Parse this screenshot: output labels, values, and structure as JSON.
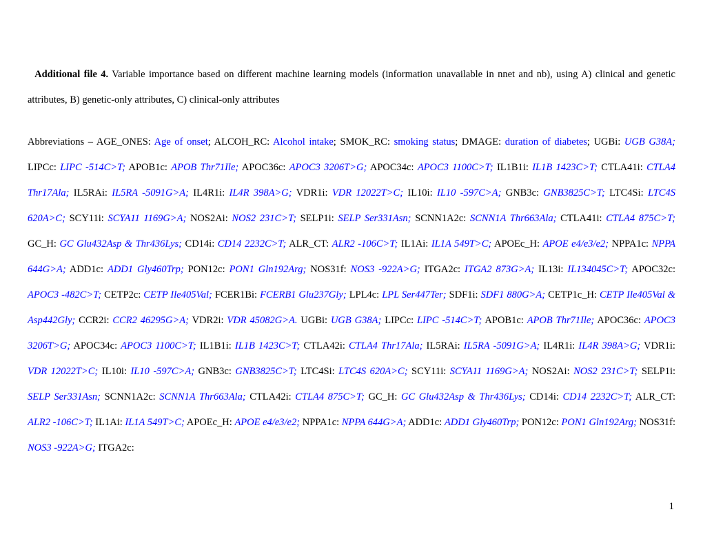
{
  "title_label": "Additional file 4.",
  "title_rest": " Variable importance based on different machine learning models (information unavailable in nnet and nb), using A) clinical and genetic attributes, B) genetic-only attributes, C) clinical-only attributes",
  "page_number": "1",
  "abbr": {
    "lead": "Abbreviations – AGE_ONES: ",
    "age_onset": "Age of onset",
    "alcoh_lbl": "; ALCOH_RC: ",
    "alcoh": "Alcohol intake",
    "smok_lbl": "; SMOK_RC: ",
    "smok": "smoking status",
    "dmage_lbl": "; DMAGE: ",
    "dmage": "duration of diabetes",
    "ugbi_lbl": "; UGBi: ",
    "ugbi": "UGB G38A;",
    "lipcc_lbl": " LIPCc: ",
    "lipcc": "LIPC -514C>T;",
    "apob1c_lbl": " APOB1c: ",
    "apob1c": "APOB  Thr71Ile;",
    "apoc36c_lbl": " APOC36c: ",
    "apoc36c": "APOC3 3206T>G;",
    "apoc34c_lbl": " APOC34c: ",
    "apoc34c": "APOC3 1100C>T;",
    "il1b1i_lbl": " IL1B1i: ",
    "il1b1i": "IL1B 1423C>T;",
    "ctla41i_lbl": " CTLA41i: ",
    "ctla41i": "CTLA4 Thr17Ala;",
    "il5rai_lbl": "  IL5RAi: ",
    "il5rai": "IL5RA -5091G>A;",
    "il4r1i_lbl": " IL4R1i: ",
    "il4r1i": "IL4R 398A>G;",
    "vdr1i_lbl": " VDR1i: ",
    "vdr1i": "VDR 12022T>C;",
    "il10i_lbl": " IL10i: ",
    "il10i": "IL10 -597C>A;",
    "gnb3c_lbl": " GNB3c: ",
    "gnb3c": "GNB3825C>T;",
    "ltc4si_lbl": " LTC4Si: ",
    "ltc4si": "LTC4S 620A>C;",
    "scy11i_lbl": " SCY11i: ",
    "scy11i": "SCYA11 1169G>A;",
    "nos2ai_lbl": " NOS2Ai: ",
    "nos2ai": "NOS2 231C>T;",
    "selp1i_lbl": " SELP1i: ",
    "selp1i": "SELP Ser331Asn;",
    "scnn1a2c_lbl": " SCNN1A2c: ",
    "scnn1a2c": "SCNN1A Thr663Ala;",
    "ctla41i2_lbl": " CTLA41i: ",
    "ctla41i2": "CTLA4 875C>T;",
    "gch_lbl": " GC_H: ",
    "gch": "GC Glu432Asp & Thr436Lys;",
    "cd14i_lbl": " CD14i: ",
    "cd14i": "CD14 2232C>T;",
    "alrct_lbl": " ALR_CT: ",
    "alrct": "ALR2  -106C>T;",
    "il1ai_lbl": " IL1Ai: ",
    "il1ai": "IL1A 549T>C;",
    "apoech_lbl": " APOEc_H: ",
    "apoech": "APOE e4/e3/e2;",
    "nppa1c_lbl": " NPPA1c: ",
    "nppa1c": "NPPA 644G>A;",
    "add1c_lbl": " ADD1c: ",
    "add1c": "ADD1 Gly460Trp;",
    "pon12c_lbl": " PON12c: ",
    "pon12c": "PON1 Gln192Arg;",
    "nos31f_lbl": " NOS31f: ",
    "nos31f": "NOS3 -922A>G;",
    "itga2c_lbl": " ITGA2c: ",
    "itga2c": "ITGA2 873G>A;",
    "il13i_lbl": " IL13i: ",
    "il13i": "IL134045C>T;",
    "apoc32c_lbl": " APOC32c: ",
    "apoc32c": "APOC3 -482C>T;",
    "cetp2c_lbl": " CETP2c: ",
    "cetp2c": "CETP Ile405Val;",
    "fcer1bi_lbl": " FCER1Bi: ",
    "fcer1bi": "FCERB1 Glu237Gly;",
    "lpl4c_lbl": " LPL4c: ",
    "lpl4c": "LPL Ser447Ter;",
    "sdf1i_lbl": " SDF1i: ",
    "sdf1i": "SDF1 880G>A;",
    "cetp1ch_lbl": " CETP1c_H: ",
    "cetp1ch": "CETP Ile405Val & Asp442Gly;",
    "ccr2i_lbl": " CCR2i: ",
    "ccr2i": "CCR2 46295G>A;",
    "vdr2i_lbl": " VDR2i: ",
    "vdr2i": "VDR 45082G>A.",
    "ugbi2_lbl": " UGBi: ",
    "ugbi2": "UGB G38A;",
    "lipcc2_lbl": " LIPCc: ",
    "lipcc2": "LIPC -514C>T;",
    "apob1c2_lbl": " APOB1c: ",
    "apob1c2": "APOB  Thr71Ile;",
    "apoc36c2_lbl": " APOC36c: ",
    "apoc36c2": "APOC3 3206T>G;",
    "apoc34c2_lbl": " APOC34c: ",
    "apoc34c2": "APOC3 1100C>T;",
    "il1b1i2_lbl": " IL1B1i: ",
    "il1b1i2": "IL1B 1423C>T;",
    "ctla42i_lbl": " CTLA42i: ",
    "ctla42i": "CTLA4 Thr17Ala;",
    "il5rai2_lbl": "  IL5RAi: ",
    "il5rai2": "IL5RA -5091G>A;",
    "il4r1i2_lbl": " IL4R1i: ",
    "il4r1i2": "IL4R 398A>G;",
    "vdr1i2_lbl": " VDR1i: ",
    "vdr1i2": "VDR 12022T>C;",
    "il10i2_lbl": " IL10i: ",
    "il10i2": "IL10 -597C>A;",
    "gnb3c2_lbl": " GNB3c: ",
    "gnb3c2": "GNB3825C>T;",
    "ltc4si2_lbl": " LTC4Si: ",
    "ltc4si2": "LTC4S 620A>C;",
    "scy11i2_lbl": " SCY11i: ",
    "scy11i2": "SCYA11 1169G>A;",
    "nos2ai2_lbl": " NOS2Ai: ",
    "nos2ai2": "NOS2 231C>T;",
    "selp1i2_lbl": " SELP1i: ",
    "selp1i2": "SELP Ser331Asn;",
    "scnn1a2c2_lbl": " SCNN1A2c: ",
    "scnn1a2c2": "SCNN1A Thr663Ala;",
    "ctla42i2_lbl": " CTLA42i: ",
    "ctla42i2": "CTLA4 875C>T;",
    "gch2_lbl": " GC_H: ",
    "gch2": "GC Glu432Asp & Thr436Lys;",
    "cd14i2_lbl": " CD14i: ",
    "cd14i2": "CD14 2232C>T;",
    "alrct2_lbl": " ALR_CT: ",
    "alrct2": "ALR2  -106C>T;",
    "il1ai2_lbl": " IL1Ai: ",
    "il1ai2": "IL1A 549T>C;",
    "apoech2_lbl": " APOEc_H: ",
    "apoech2": "APOE e4/e3/e2;",
    "nppa1c2_lbl": " NPPA1c: ",
    "nppa1c2": "NPPA 644G>A;",
    "add1c2_lbl": " ADD1c: ",
    "add1c2": "ADD1 Gly460Trp;",
    "pon12c2_lbl": " PON12c: ",
    "pon12c2": "PON1 Gln192Arg;",
    "nos31f2_lbl": " NOS31f: ",
    "nos31f2": "NOS3 -922A>G;",
    "itga2c2_lbl": " ITGA2c: "
  }
}
